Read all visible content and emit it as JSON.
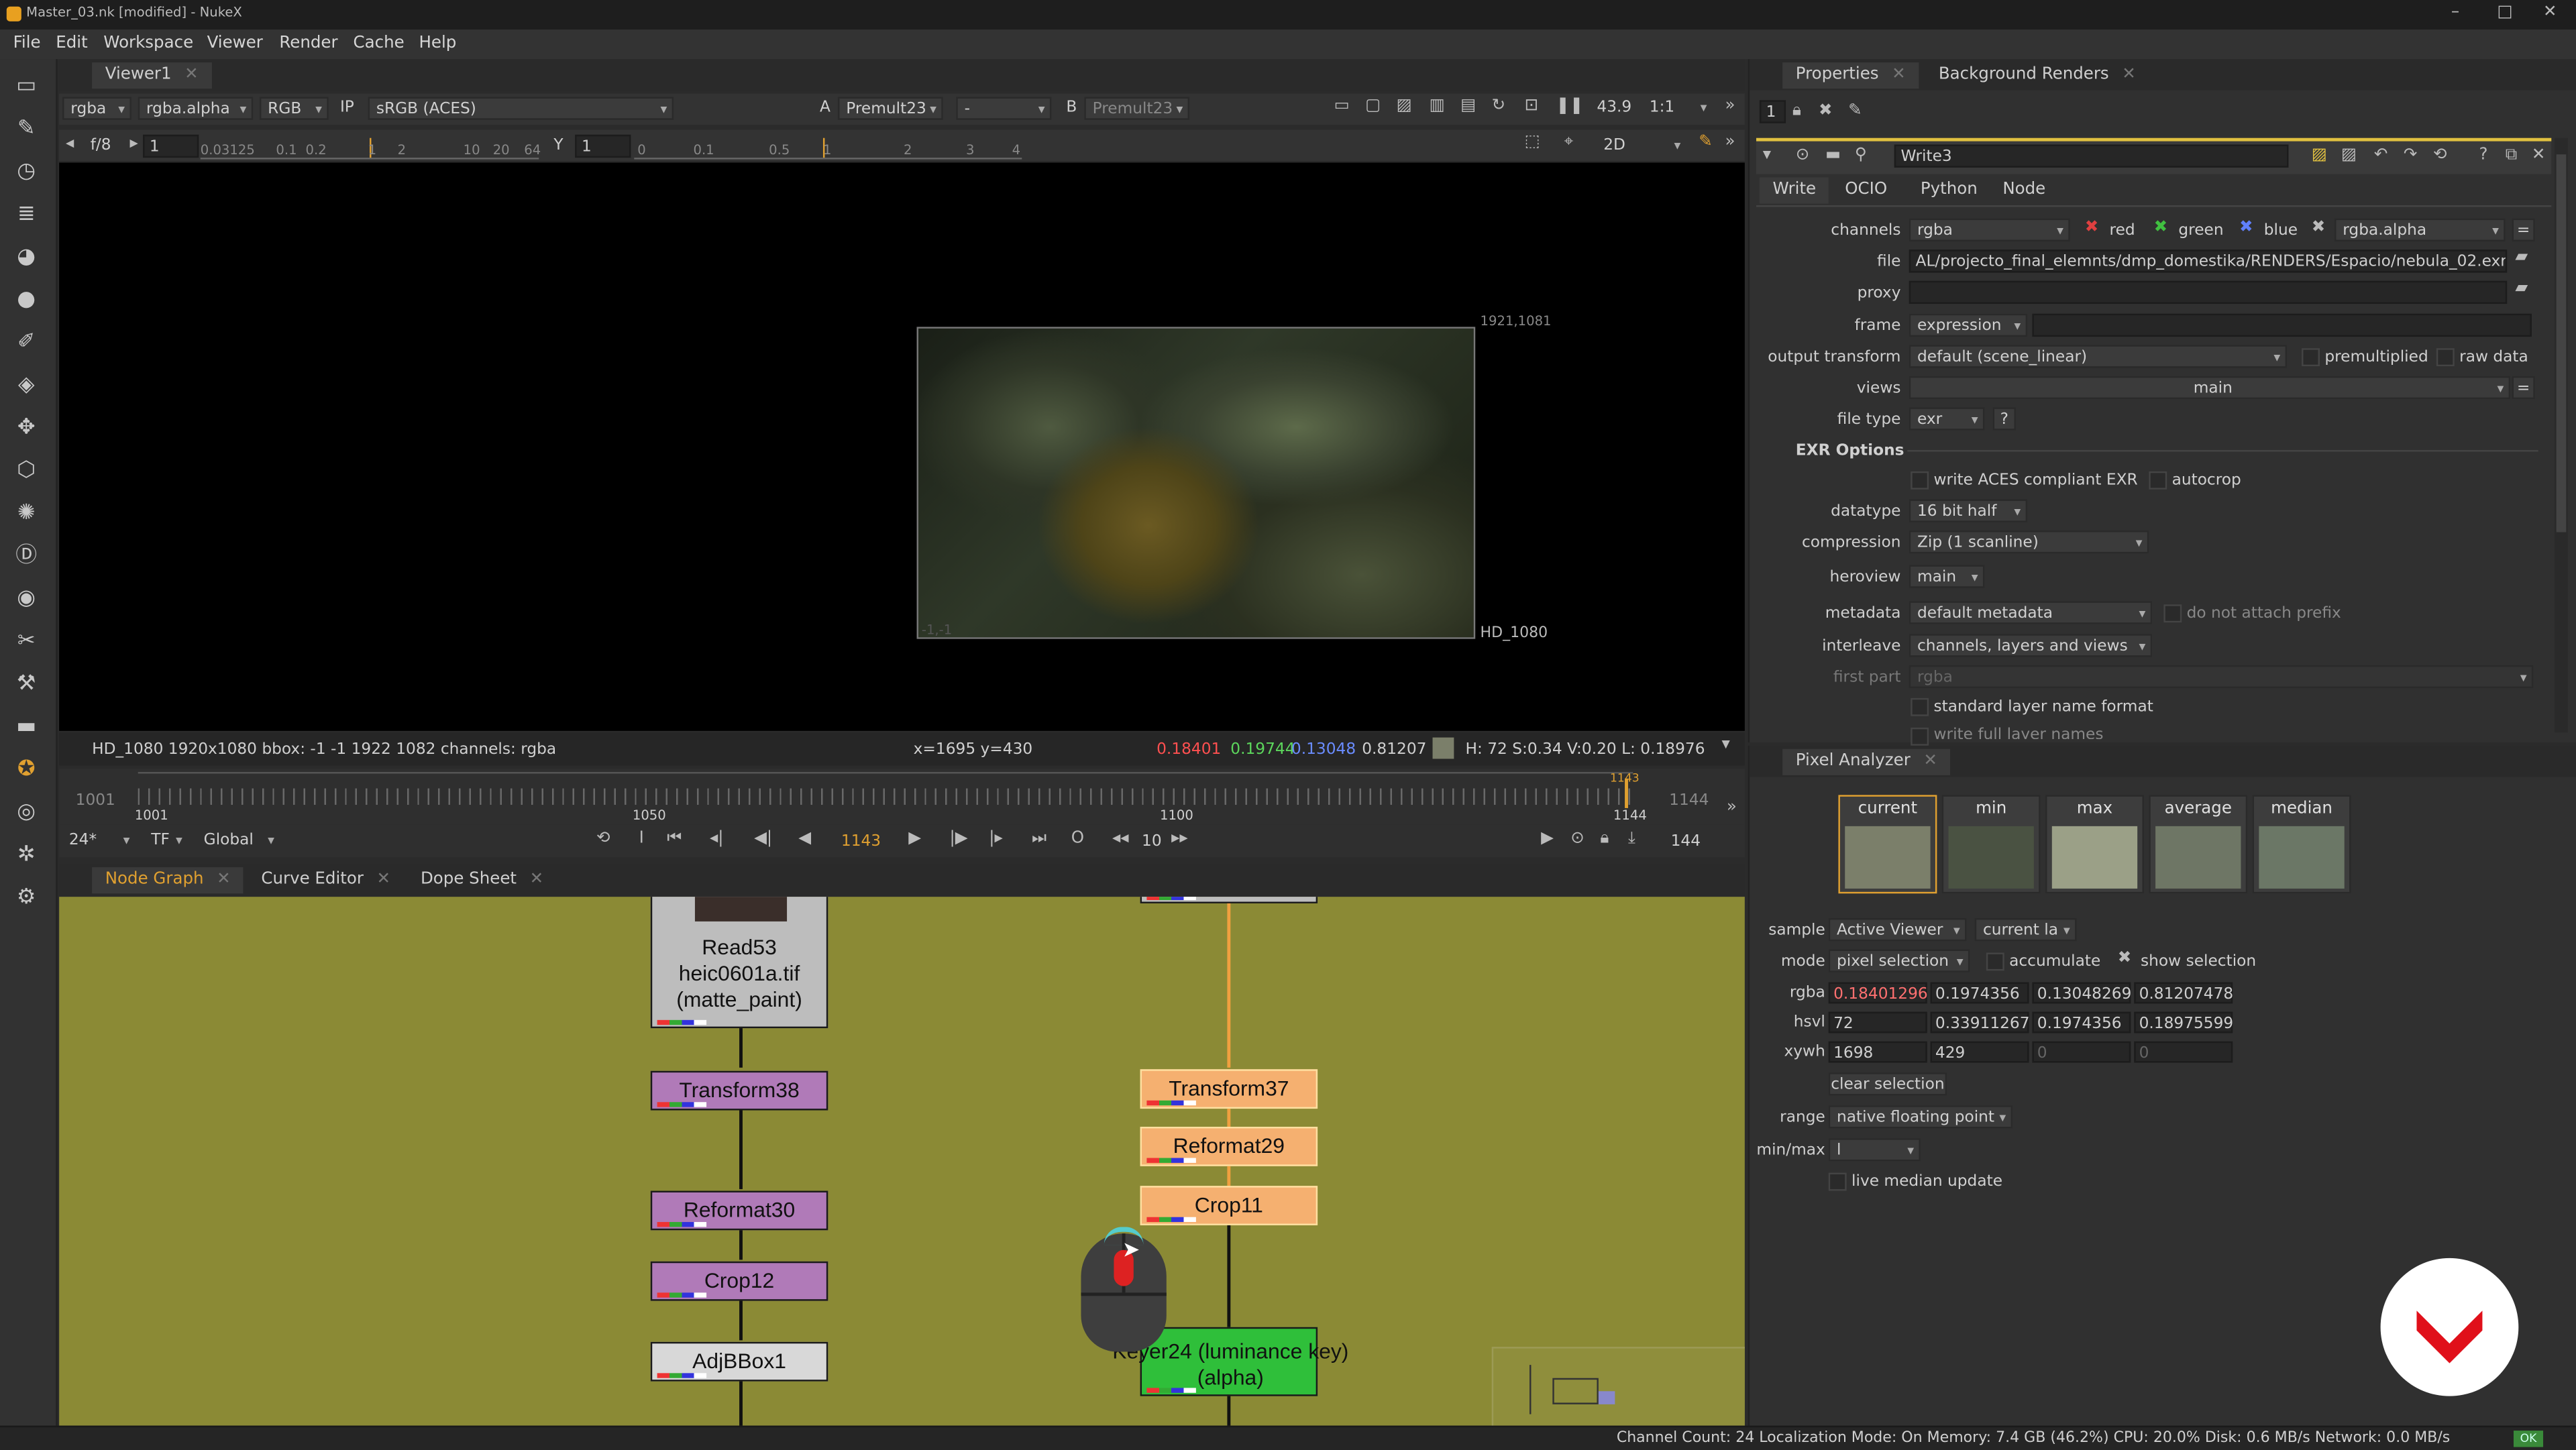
{
  "window": {
    "title": "Master_03.nk [modified] - NukeX",
    "minimize": "–",
    "maximize": "□",
    "close": "✕"
  },
  "menu": [
    "File",
    "Edit",
    "Workspace",
    "Viewer",
    "Render",
    "Cache",
    "Help"
  ],
  "viewer": {
    "tab": "Viewer1",
    "channels": "rgba",
    "alpha": "rgba.alpha",
    "colorspace": "RGB",
    "ip": "IP",
    "display": "sRGB (ACES)",
    "a_label": "A",
    "a_input": "Premult23",
    "dash": "-",
    "b_label": "B",
    "b_input": "Premult23",
    "zoom": "43.9",
    "ratio": "1:1",
    "fstop": "f/8",
    "gain": "1",
    "y_label": "Y",
    "gamma": "1",
    "mode2d": "2D",
    "scale1": [
      "0.03125",
      "0.1",
      "0.2",
      "1",
      "2",
      "10",
      "20",
      "64"
    ],
    "scale2": [
      "0",
      "0.1",
      "0.5",
      "1",
      "2",
      "3",
      "4"
    ],
    "corner_tr": "1921,1081",
    "corner_br": "HD_1080",
    "corner_bl": "-1,-1",
    "info_left": "HD_1080 1920x1080  bbox: -1 -1 1922 1082 channels: rgba",
    "coords": "x=1695 y=430",
    "r": "0.18401",
    "g": "0.19744",
    "b": "0.13048",
    "a": "0.81207",
    "hsv": "H: 72 S:0.34 V:0.20  L: 0.18976"
  },
  "timeline": {
    "start": "1001",
    "end": "1144",
    "t1": "1001",
    "t2": "1050",
    "t3": "1100",
    "t4": "1144",
    "cursor_top": "1143",
    "fps": "24*",
    "tf": "TF",
    "global": "Global",
    "current": "1143",
    "step": "10",
    "count": "144",
    "frame_o": "O",
    "in_i": "I"
  },
  "nodegraph": {
    "tabs": [
      "Node Graph",
      "Curve Editor",
      "Dope Sheet"
    ],
    "nodes": {
      "read": "Read53\nheic0601a.tif\n(matte_paint)",
      "transform38": "Transform38",
      "reformat30": "Reformat30",
      "crop12": "Crop12",
      "adjbbox": "AdjBBox1",
      "transform37": "Transform37",
      "reformat29": "Reformat29",
      "crop11": "Crop11",
      "keyer": "Keyer24 (luminance key)\n(alpha)"
    }
  },
  "properties": {
    "tabs": [
      "Properties",
      "Background Renders"
    ],
    "count": "1",
    "node_name": "Write3",
    "subtabs": [
      "Write",
      "OCIO",
      "Python",
      "Node"
    ],
    "channels": {
      "label": "channels",
      "value": "rgba",
      "red": "red",
      "green": "green",
      "blue": "blue",
      "alpha": "rgba.alpha"
    },
    "file": {
      "label": "file",
      "value": "AL/projecto_final_elemnts/dmp_domestika/RENDERS/Espacio/nebula_02.exr"
    },
    "proxy": {
      "label": "proxy",
      "value": ""
    },
    "frame": {
      "label": "frame",
      "value": "expression"
    },
    "output_transform": {
      "label": "output transform",
      "value": "default (scene_linear)",
      "premultiplied": "premultiplied",
      "raw": "raw data"
    },
    "views": {
      "label": "views",
      "value": "main"
    },
    "file_type": {
      "label": "file type",
      "value": "exr",
      "help": "?"
    },
    "exr_header": "EXR Options",
    "aces": "write ACES compliant EXR",
    "autocrop": "autocrop",
    "datatype": {
      "label": "datatype",
      "value": "16 bit half"
    },
    "compression": {
      "label": "compression",
      "value": "Zip (1 scanline)"
    },
    "heroview": {
      "label": "heroview",
      "value": "main"
    },
    "metadata": {
      "label": "metadata",
      "value": "default metadata",
      "noprefix": "do not attach prefix"
    },
    "interleave": {
      "label": "interleave",
      "value": "channels, layers and views"
    },
    "first_part": {
      "label": "first part",
      "value": "rgba"
    },
    "standard_layer": "standard layer name format",
    "write_full": "write full layer names"
  },
  "pixel_analyzer": {
    "tab": "Pixel Analyzer",
    "swatches": [
      {
        "label": "current",
        "color": "#7b7f6a"
      },
      {
        "label": "min",
        "color": "#4a5242"
      },
      {
        "label": "max",
        "color": "#9ba087"
      },
      {
        "label": "average",
        "color": "#6e7665"
      },
      {
        "label": "median",
        "color": "#6b7766"
      }
    ],
    "sample": {
      "label": "sample",
      "value": "Active Viewer",
      "value2": "current la"
    },
    "mode": {
      "label": "mode",
      "value": "pixel selection",
      "accumulate": "accumulate",
      "show": "show selection"
    },
    "rgba": {
      "label": "rgba",
      "values": [
        "0.18401296",
        "0.1974356",
        "0.13048269",
        "0.81207478"
      ]
    },
    "hsvl": {
      "label": "hsvl",
      "values": [
        "72",
        "0.33911267",
        "0.1974356",
        "0.18975599"
      ]
    },
    "xywh": {
      "label": "xywh",
      "values": [
        "1698",
        "429",
        "0",
        "0"
      ]
    },
    "clear": "clear selection",
    "range": {
      "label": "range",
      "value": "native floating point"
    },
    "minmax": {
      "label": "min/max",
      "value": "l"
    },
    "live": "live median update"
  },
  "status": "Channel Count: 24  Localization Mode: On  Memory: 7.4 GB (46.2%)  CPU: 20.0%  Disk: 0.6 MB/s  Network: 0.0 MB/s",
  "status_ok": "OK"
}
